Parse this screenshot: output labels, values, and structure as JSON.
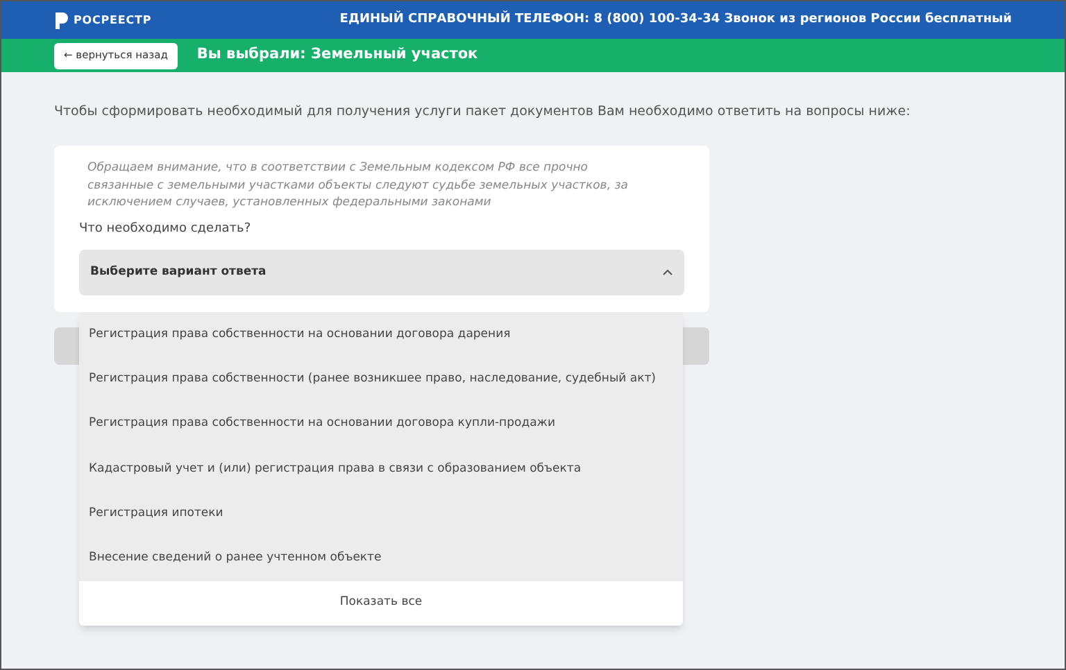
{
  "header": {
    "logo": "РОСРЕЕСТР",
    "hotline": "ЕДИНЫЙ СПРАВОЧНЫЙ ТЕЛЕФОН: 8 (800) 100-34-34 Звонок из регионов России бесплатный"
  },
  "subheader": {
    "back_button": "← вернуться назад",
    "title": "Вы выбрали: Земельный участок"
  },
  "intro": "Чтобы сформировать необходимый для получения услуги пакет документов Вам необходимо ответить на вопросы ниже:",
  "card": {
    "notice": "Обращаем внимание, что в соответствии с Земельным кодексом РФ все прочно связанные с земельными участками объекты следуют судьбе земельных участков, за исключением случаев, установленных федеральными законами",
    "question": "Что необходимо сделать?",
    "select": {
      "placeholder": "Выберите вариант ответа",
      "expanded": true
    }
  },
  "dropdown": {
    "options": [
      {
        "label": "Регистрация права собственности на основании договора дарения"
      },
      {
        "label": "Регистрация права собственности (ранее возникшее право, наследование, судебный акт)"
      },
      {
        "label": "Регистрация права собственности на основании договора купли-продажи"
      },
      {
        "label": "Кадастровый учет и (или) регистрация права в связи с образованием объекта"
      },
      {
        "label": "Регистрация ипотеки"
      },
      {
        "label": "Внесение сведений о ранее учтенном объекте"
      }
    ],
    "show_all": "Показать все"
  }
}
